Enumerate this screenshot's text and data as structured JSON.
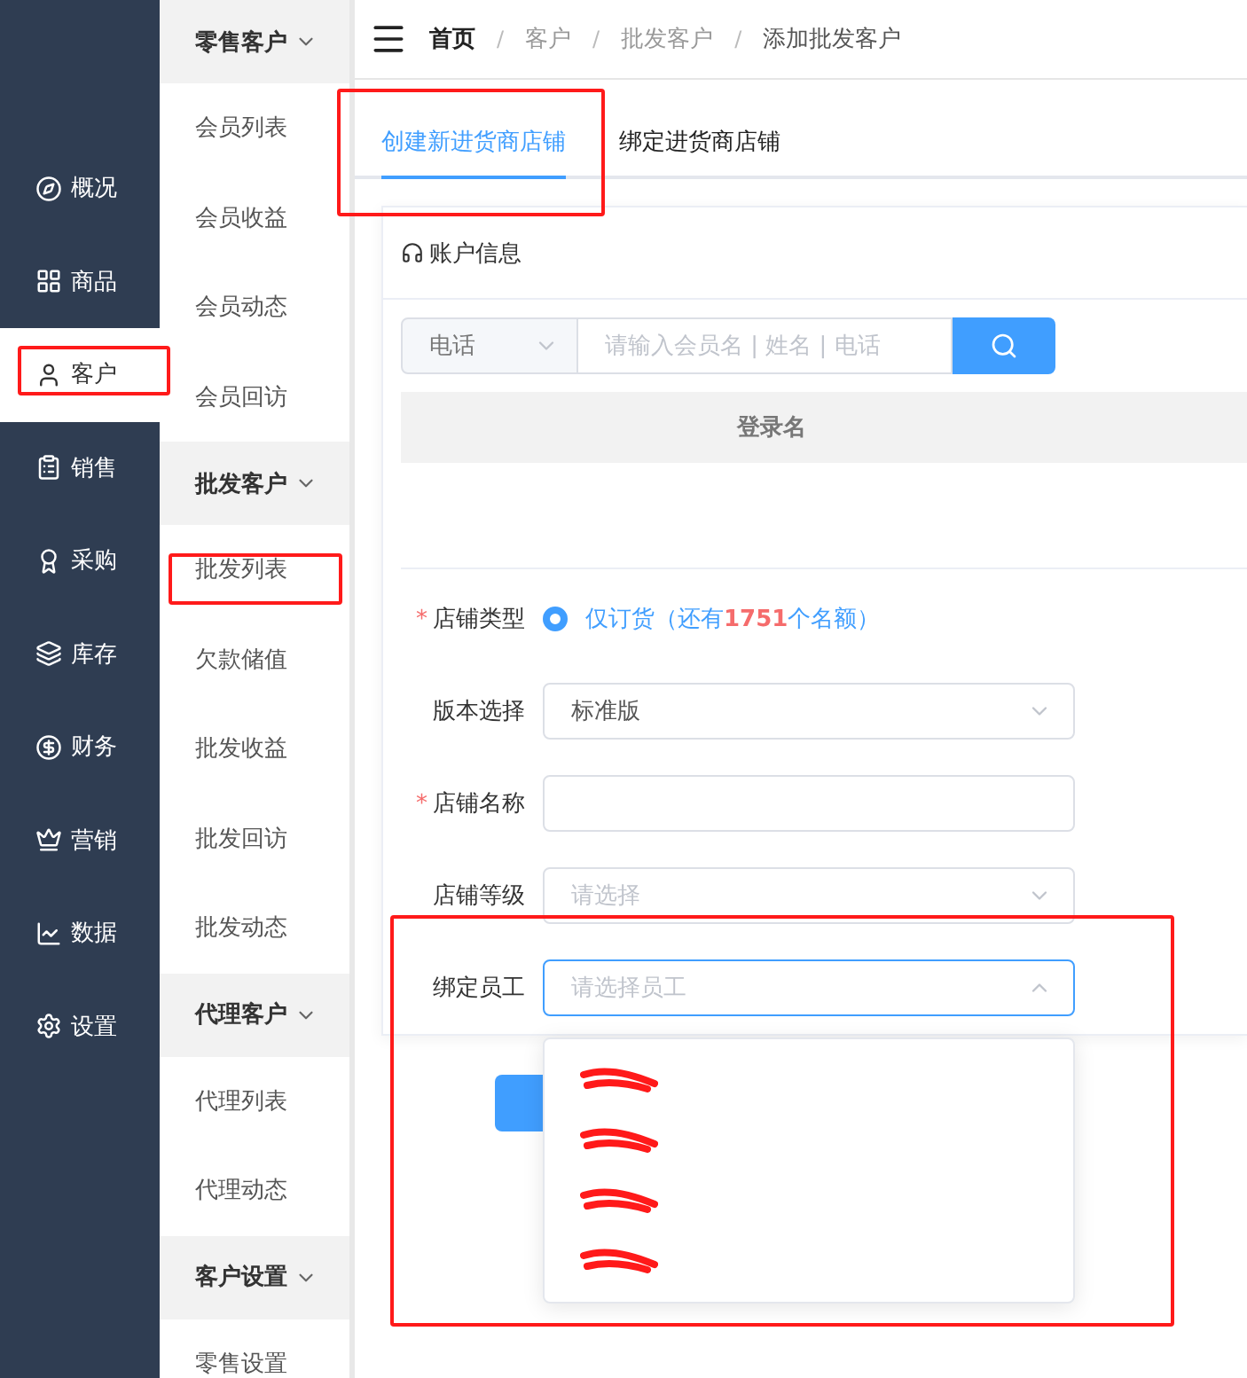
{
  "main_nav": [
    {
      "label": "概况",
      "selected": false
    },
    {
      "label": "商品",
      "selected": false
    },
    {
      "label": "客户",
      "selected": true
    },
    {
      "label": "销售",
      "selected": false
    },
    {
      "label": "采购",
      "selected": false
    },
    {
      "label": "库存",
      "selected": false
    },
    {
      "label": "财务",
      "selected": false
    },
    {
      "label": "营销",
      "selected": false
    },
    {
      "label": "数据",
      "selected": false
    },
    {
      "label": "设置",
      "selected": false
    }
  ],
  "sub_nav": [
    {
      "label": "零售客户",
      "expanded": true,
      "children": [
        {
          "label": "会员列表"
        },
        {
          "label": "会员收益"
        },
        {
          "label": "会员动态"
        },
        {
          "label": "会员回访"
        }
      ]
    },
    {
      "label": "批发客户",
      "expanded": true,
      "children": [
        {
          "label": "批发列表"
        },
        {
          "label": "欠款储值"
        },
        {
          "label": "批发收益"
        },
        {
          "label": "批发回访"
        },
        {
          "label": "批发动态"
        }
      ]
    },
    {
      "label": "代理客户",
      "expanded": true,
      "children": [
        {
          "label": "代理列表"
        },
        {
          "label": "代理动态"
        }
      ]
    },
    {
      "label": "客户设置",
      "expanded": true,
      "children": [
        {
          "label": "零售设置"
        }
      ]
    }
  ],
  "breadcrumb": [
    "首页",
    "客户",
    "批发客户",
    "添加批发客户"
  ],
  "breadcrumb_separator": "/",
  "required_mark": "*",
  "tabs": [
    {
      "label": "创建新进货商店铺",
      "selected": true
    },
    {
      "label": "绑定进货商店铺",
      "selected": false
    }
  ],
  "account_card": {
    "title": "账户信息",
    "search_type": "电话",
    "search_placeholder": "请输入会员名 | 姓名 | 电话",
    "table_columns": [
      "登录名"
    ]
  },
  "form": [
    {
      "kind": "radio",
      "label": "店铺类型",
      "required": true,
      "option": "仅订货（还有**1751**个名额）",
      "checked": true
    },
    {
      "kind": "select",
      "label": "版本选择",
      "required": false,
      "value": "标准版",
      "open": false
    },
    {
      "kind": "input",
      "label": "店铺名称",
      "required": true
    },
    {
      "kind": "select",
      "label": "店铺等级",
      "required": false,
      "placeholder": "请选择",
      "open": false
    },
    {
      "kind": "select",
      "label": "绑定员工",
      "required": false,
      "placeholder": "请选择员工",
      "open": true,
      "options": [
        {
          "redacted": true
        },
        {
          "redacted": true
        },
        {
          "redacted": true
        },
        {
          "redacted": true
        }
      ]
    }
  ]
}
